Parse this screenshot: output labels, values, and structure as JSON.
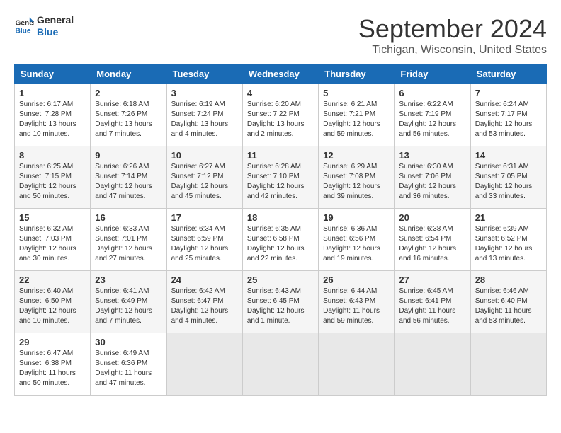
{
  "header": {
    "logo_general": "General",
    "logo_blue": "Blue",
    "month": "September 2024",
    "location": "Tichigan, Wisconsin, United States"
  },
  "days_of_week": [
    "Sunday",
    "Monday",
    "Tuesday",
    "Wednesday",
    "Thursday",
    "Friday",
    "Saturday"
  ],
  "weeks": [
    [
      {
        "day": "1",
        "sunrise": "6:17 AM",
        "sunset": "7:28 PM",
        "daylight": "13 hours and 10 minutes"
      },
      {
        "day": "2",
        "sunrise": "6:18 AM",
        "sunset": "7:26 PM",
        "daylight": "13 hours and 7 minutes"
      },
      {
        "day": "3",
        "sunrise": "6:19 AM",
        "sunset": "7:24 PM",
        "daylight": "13 hours and 4 minutes"
      },
      {
        "day": "4",
        "sunrise": "6:20 AM",
        "sunset": "7:22 PM",
        "daylight": "13 hours and 2 minutes"
      },
      {
        "day": "5",
        "sunrise": "6:21 AM",
        "sunset": "7:21 PM",
        "daylight": "12 hours and 59 minutes"
      },
      {
        "day": "6",
        "sunrise": "6:22 AM",
        "sunset": "7:19 PM",
        "daylight": "12 hours and 56 minutes"
      },
      {
        "day": "7",
        "sunrise": "6:24 AM",
        "sunset": "7:17 PM",
        "daylight": "12 hours and 53 minutes"
      }
    ],
    [
      {
        "day": "8",
        "sunrise": "6:25 AM",
        "sunset": "7:15 PM",
        "daylight": "12 hours and 50 minutes"
      },
      {
        "day": "9",
        "sunrise": "6:26 AM",
        "sunset": "7:14 PM",
        "daylight": "12 hours and 47 minutes"
      },
      {
        "day": "10",
        "sunrise": "6:27 AM",
        "sunset": "7:12 PM",
        "daylight": "12 hours and 45 minutes"
      },
      {
        "day": "11",
        "sunrise": "6:28 AM",
        "sunset": "7:10 PM",
        "daylight": "12 hours and 42 minutes"
      },
      {
        "day": "12",
        "sunrise": "6:29 AM",
        "sunset": "7:08 PM",
        "daylight": "12 hours and 39 minutes"
      },
      {
        "day": "13",
        "sunrise": "6:30 AM",
        "sunset": "7:06 PM",
        "daylight": "12 hours and 36 minutes"
      },
      {
        "day": "14",
        "sunrise": "6:31 AM",
        "sunset": "7:05 PM",
        "daylight": "12 hours and 33 minutes"
      }
    ],
    [
      {
        "day": "15",
        "sunrise": "6:32 AM",
        "sunset": "7:03 PM",
        "daylight": "12 hours and 30 minutes"
      },
      {
        "day": "16",
        "sunrise": "6:33 AM",
        "sunset": "7:01 PM",
        "daylight": "12 hours and 27 minutes"
      },
      {
        "day": "17",
        "sunrise": "6:34 AM",
        "sunset": "6:59 PM",
        "daylight": "12 hours and 25 minutes"
      },
      {
        "day": "18",
        "sunrise": "6:35 AM",
        "sunset": "6:58 PM",
        "daylight": "12 hours and 22 minutes"
      },
      {
        "day": "19",
        "sunrise": "6:36 AM",
        "sunset": "6:56 PM",
        "daylight": "12 hours and 19 minutes"
      },
      {
        "day": "20",
        "sunrise": "6:38 AM",
        "sunset": "6:54 PM",
        "daylight": "12 hours and 16 minutes"
      },
      {
        "day": "21",
        "sunrise": "6:39 AM",
        "sunset": "6:52 PM",
        "daylight": "12 hours and 13 minutes"
      }
    ],
    [
      {
        "day": "22",
        "sunrise": "6:40 AM",
        "sunset": "6:50 PM",
        "daylight": "12 hours and 10 minutes"
      },
      {
        "day": "23",
        "sunrise": "6:41 AM",
        "sunset": "6:49 PM",
        "daylight": "12 hours and 7 minutes"
      },
      {
        "day": "24",
        "sunrise": "6:42 AM",
        "sunset": "6:47 PM",
        "daylight": "12 hours and 4 minutes"
      },
      {
        "day": "25",
        "sunrise": "6:43 AM",
        "sunset": "6:45 PM",
        "daylight": "12 hours and 1 minute"
      },
      {
        "day": "26",
        "sunrise": "6:44 AM",
        "sunset": "6:43 PM",
        "daylight": "11 hours and 59 minutes"
      },
      {
        "day": "27",
        "sunrise": "6:45 AM",
        "sunset": "6:41 PM",
        "daylight": "11 hours and 56 minutes"
      },
      {
        "day": "28",
        "sunrise": "6:46 AM",
        "sunset": "6:40 PM",
        "daylight": "11 hours and 53 minutes"
      }
    ],
    [
      {
        "day": "29",
        "sunrise": "6:47 AM",
        "sunset": "6:38 PM",
        "daylight": "11 hours and 50 minutes"
      },
      {
        "day": "30",
        "sunrise": "6:49 AM",
        "sunset": "6:36 PM",
        "daylight": "11 hours and 47 minutes"
      },
      null,
      null,
      null,
      null,
      null
    ]
  ]
}
